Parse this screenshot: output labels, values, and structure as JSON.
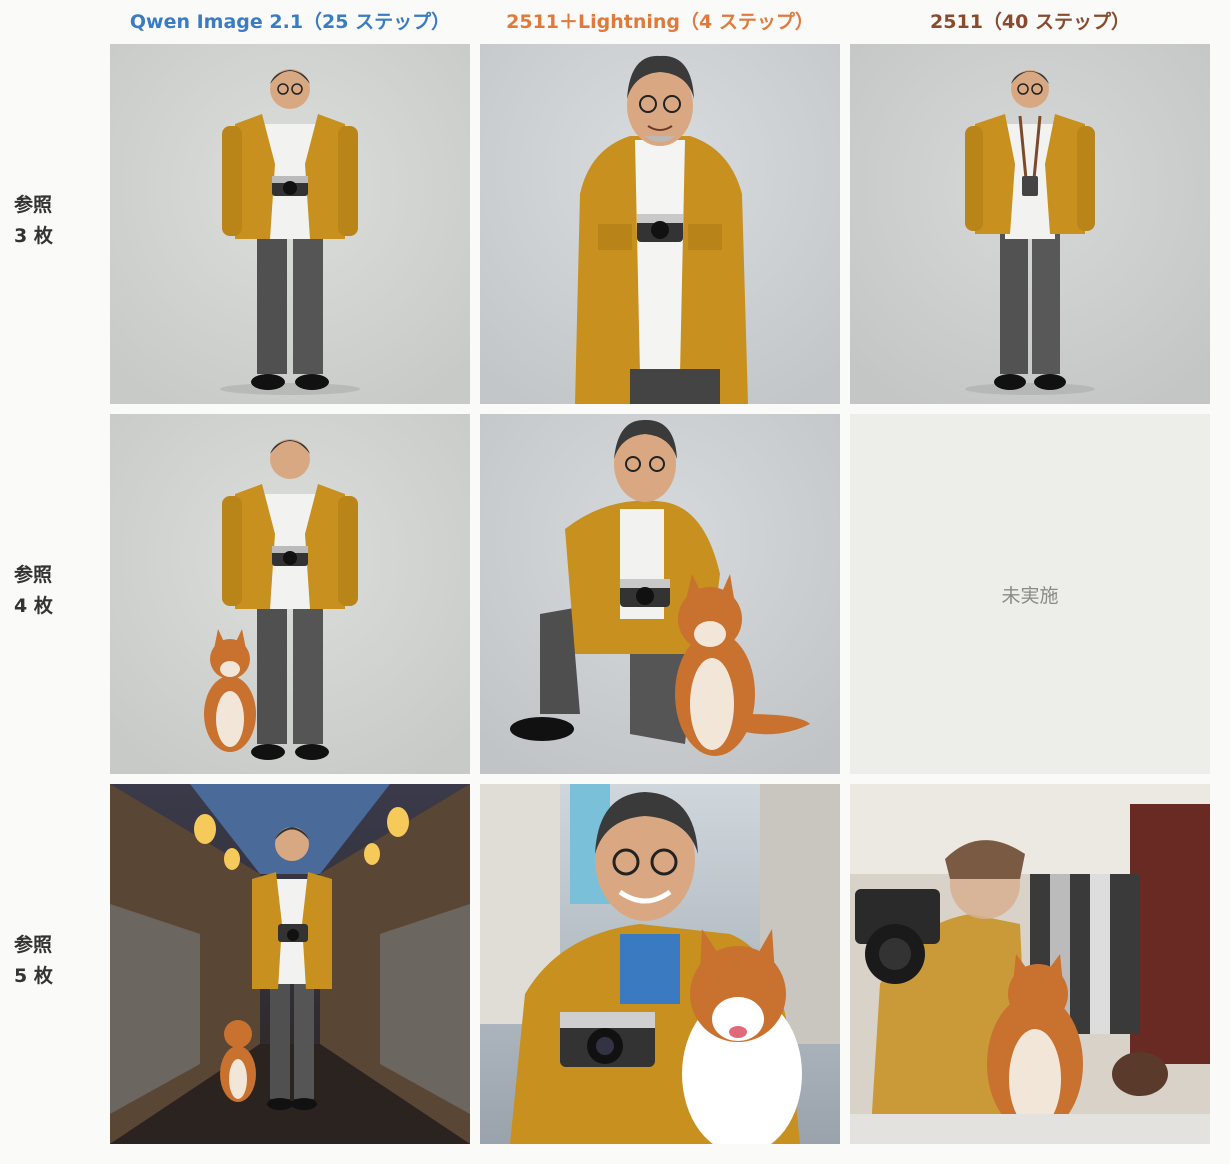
{
  "columns": [
    {
      "title": "Qwen Image 2.1（25 ステップ）",
      "color": "#3a7cc4"
    },
    {
      "title": "2511＋Lightning（4 ステップ）",
      "color": "#e07a3c"
    },
    {
      "title": "2511（40 ステップ）",
      "color": "#8a4a2e"
    }
  ],
  "rows": [
    {
      "label_line1": "参照",
      "label_line2": "3 枚"
    },
    {
      "label_line1": "参照",
      "label_line2": "4 枚"
    },
    {
      "label_line1": "参照",
      "label_line2": "5 枚"
    }
  ],
  "cells": {
    "r2c3": {
      "status": "未実施"
    }
  },
  "palette": {
    "jacket": "#c8901e",
    "studio_bg": "#d6d8d6",
    "shiba": "#c9712f"
  }
}
